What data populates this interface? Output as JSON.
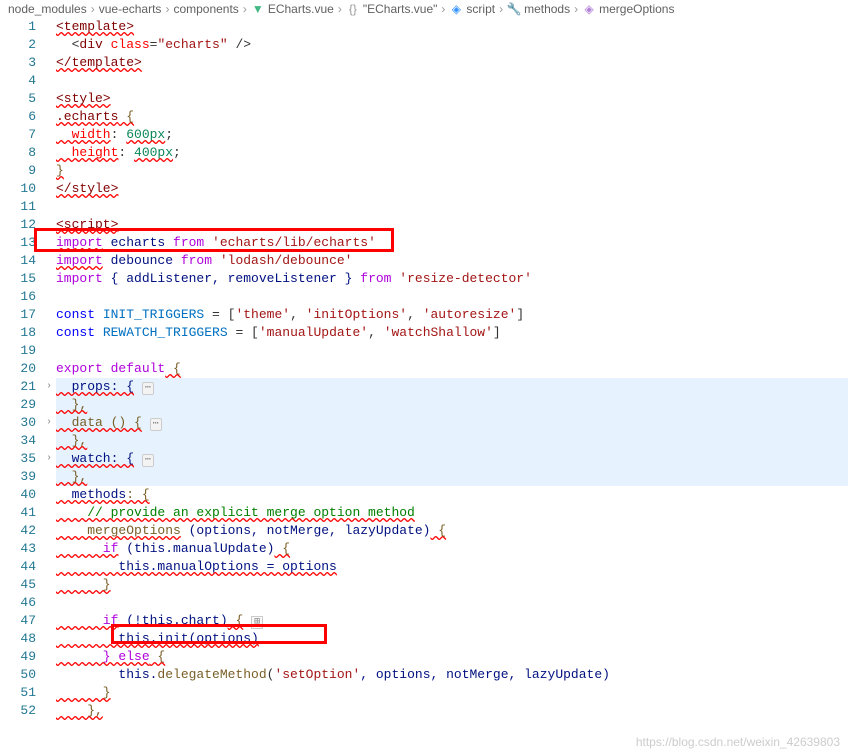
{
  "breadcrumb": {
    "items": [
      {
        "label": "node_modules",
        "icon": null
      },
      {
        "label": "vue-echarts",
        "icon": null
      },
      {
        "label": "components",
        "icon": null
      },
      {
        "label": "ECharts.vue",
        "icon": "vue-file"
      },
      {
        "label": "\"ECharts.vue\"",
        "icon": "braces"
      },
      {
        "label": "script",
        "icon": "cube-blue"
      },
      {
        "label": "methods",
        "icon": "wrench"
      },
      {
        "label": "mergeOptions",
        "icon": "cube-purple"
      }
    ]
  },
  "gutter": [
    "1",
    "2",
    "3",
    "4",
    "5",
    "6",
    "7",
    "8",
    "9",
    "10",
    "11",
    "12",
    "13",
    "14",
    "15",
    "16",
    "17",
    "18",
    "19",
    "20",
    "21",
    "29",
    "30",
    "34",
    "35",
    "39",
    "40",
    "41",
    "42",
    "43",
    "44",
    "45",
    "46",
    "47",
    "48",
    "49",
    "50",
    "51",
    "52"
  ],
  "folds": {
    "21": true,
    "30": true,
    "35": true
  },
  "code": {
    "l1": "<template>",
    "l2_indent": "  <",
    "l2_tag": "div",
    "l2_attr": "class",
    "l2_val": "\"echarts\"",
    "l2_end": " />",
    "l3": "</template>",
    "l5": "<style>",
    "l6_sel": ".echarts",
    "l6_brace": " {",
    "l7_prop": "  width",
    "l7_val": "600px",
    "l8_prop": "  height",
    "l8_val": "400px",
    "l9": "}",
    "l10": "</style>",
    "l12": "<script>",
    "l13_kw": "import",
    "l13_id": " echarts ",
    "l13_from": "from",
    "l13_str": " 'echarts/lib/echarts'",
    "l14_kw": "import",
    "l14_id": " debounce ",
    "l14_from": "from",
    "l14_str": " 'lodash/debounce'",
    "l15_kw": "import",
    "l15_mid": " { addListener, removeListener } ",
    "l15_from": "from",
    "l15_str": " 'resize-detector'",
    "l17_kw": "const",
    "l17_name": " INIT_TRIGGERS ",
    "l17_eq": "= [",
    "l17_s1": "'theme'",
    "l17_s2": "'initOptions'",
    "l17_s3": "'autoresize'",
    "l18_kw": "const",
    "l18_name": " REWATCH_TRIGGERS ",
    "l18_eq": "= [",
    "l18_s1": "'manualUpdate'",
    "l18_s2": "'watchShallow'",
    "l20_kw": "export default",
    "l20_brace": " {",
    "l21": "  props: {",
    "l29": "  },",
    "l30": "  data () {",
    "l34": "  },",
    "l35": "  watch: {",
    "l39": "  },",
    "l40_key": "  methods",
    "l40_brace": ": {",
    "l41": "    // provide an explicit merge option method",
    "l42_fn": "    mergeOptions",
    "l42_args": " (options, notMerge, lazyUpdate)",
    "l42_brace": " {",
    "l43_kw": "      if",
    "l43_cond": " (this.manualUpdate)",
    "l43_brace": " {",
    "l44": "        this.manualOptions = options",
    "l45": "      }",
    "l47_kw": "      if",
    "l47_cond": " (!this.chart)",
    "l47_brace": " {",
    "l48": "        this.init(options)",
    "l49_kw": "      } else",
    "l49_brace": " {",
    "l50_a": "        this.",
    "l50_fn": "delegateMethod",
    "l50_b": "(",
    "l50_str": "'setOption'",
    "l50_c": ", options, notMerge, lazyUpdate)",
    "l51": "      }",
    "l52": "    },"
  },
  "watermark": "https://blog.csdn.net/weixin_42639803"
}
